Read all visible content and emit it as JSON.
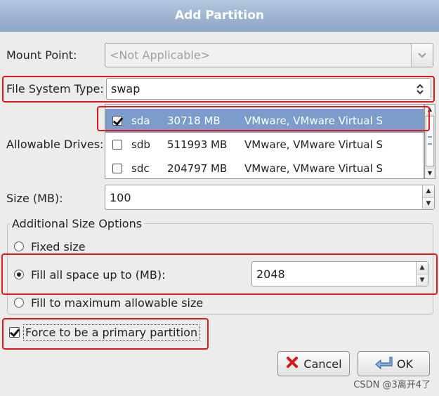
{
  "window": {
    "title": "Add Partition"
  },
  "mount_point": {
    "label": "Mount Point:",
    "value": "<Not Applicable>"
  },
  "fs_type": {
    "label": "File System Type:",
    "value": "swap"
  },
  "drives": {
    "label": "Allowable Drives:",
    "rows": [
      {
        "checked": true,
        "name": "sda",
        "size": "30718 MB",
        "model": "VMware, VMware Virtual S"
      },
      {
        "checked": false,
        "name": "sdb",
        "size": "511993 MB",
        "model": "VMware, VMware Virtual S"
      },
      {
        "checked": false,
        "name": "sdc",
        "size": "204797 MB",
        "model": "VMware, VMware Virtual S"
      }
    ]
  },
  "size": {
    "label": "Size (MB):",
    "value": "100"
  },
  "size_options": {
    "title": "Additional Size Options",
    "fixed": "Fixed size",
    "fill_upto": "Fill all space up to (MB):",
    "fill_upto_value": "2048",
    "fill_max": "Fill to maximum allowable size",
    "selected": "fill_upto"
  },
  "primary": {
    "label": "Force to be a primary partition",
    "checked": true
  },
  "buttons": {
    "cancel": "Cancel",
    "ok": "OK"
  },
  "watermark": "CSDN @3离开4了",
  "colors": {
    "highlight": "#e3161c",
    "selection": "#7c9dcc"
  }
}
